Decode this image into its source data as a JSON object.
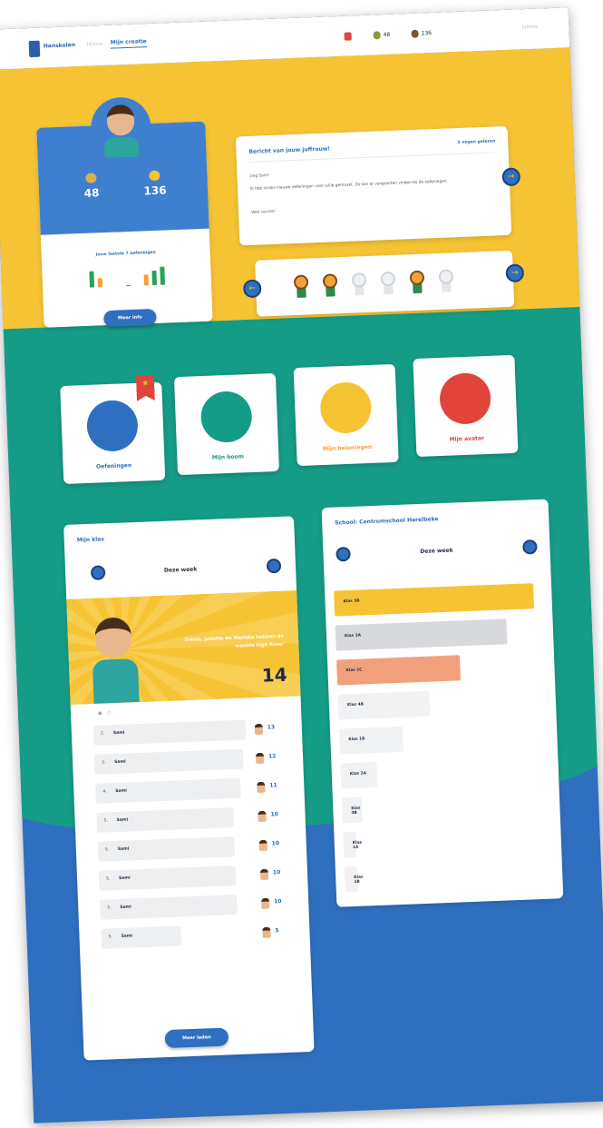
{
  "nav": {
    "logo_text": "Hanskolen",
    "links": [
      "Home",
      "Mijn creatie"
    ],
    "high_fives": "48",
    "badge_count": "136",
    "user_menu": "Juliette"
  },
  "profile": {
    "coins": "48",
    "high_fives": "136",
    "coins_label": "",
    "high_fives_label": "",
    "rewards_label": "Jouw laatste 7 oefeningen",
    "button_label": "Meer info",
    "mini_bars": [
      0.9,
      0.5,
      0.0,
      0.6,
      0.8,
      1.0
    ]
  },
  "message": {
    "title": "Bericht van jouw juffrouw!",
    "more_link": "3 nogen gelezen",
    "greeting": "Dag Sam!",
    "body": "Ik heb straks nieuwe oefeningen voor jullie gemaakt. Ze kan er vergaarden vinden bij de oefeningen.",
    "sign_off": "Veel succes!"
  },
  "badges": {
    "states": [
      "gold",
      "gold",
      "grey",
      "grey",
      "gold",
      "grey"
    ]
  },
  "tiles": [
    {
      "label": "Oefeningen",
      "color": "#2f6fbf",
      "label_color": "#2f6fbf"
    },
    {
      "label": "Mijn boom",
      "color": "#159c86",
      "label_color": "#159c86"
    },
    {
      "label": "Mijn beloningen",
      "color": "#f6c334",
      "label_color": "#f6a134"
    },
    {
      "label": "Mijn avatar",
      "color": "#e0443a",
      "label_color": "#e0443a"
    }
  ],
  "klas": {
    "title": "Mijn klas",
    "week": "Deze week",
    "hero_text": "Simon, Juliette en Mariska hebben de meeste high fives!",
    "hero_number": "14",
    "rows": [
      {
        "pos": "2.",
        "name": "Sami",
        "score": "13",
        "fill": 0.8
      },
      {
        "pos": "3.",
        "name": "Sami",
        "score": "12",
        "fill": 0.78
      },
      {
        "pos": "4.",
        "name": "Sami",
        "score": "11",
        "fill": 0.76
      },
      {
        "pos": "5.",
        "name": "Sami",
        "score": "10",
        "fill": 0.72
      },
      {
        "pos": "5.",
        "name": "Sami",
        "score": "10",
        "fill": 0.72
      },
      {
        "pos": "5.",
        "name": "Sami",
        "score": "10",
        "fill": 0.72
      },
      {
        "pos": "5.",
        "name": "Sami",
        "score": "10",
        "fill": 0.72
      },
      {
        "pos": "5.",
        "name": "Sami",
        "score": "5",
        "fill": 0.42
      }
    ],
    "button_label": "Meer laden"
  },
  "school": {
    "title": "School: Centrumschool Harelbeke",
    "week": "Deze week",
    "rows": [
      {
        "label": "Klas 5B",
        "fill": 1.0,
        "color": "#f6c334"
      },
      {
        "label": "Klas 3A",
        "fill": 0.86,
        "color": "#d7d9dd"
      },
      {
        "label": "Klas 2C",
        "fill": 0.62,
        "color": "#f2a07c"
      },
      {
        "label": "Klas 4B",
        "fill": 0.46,
        "color": "#f1f2f4"
      },
      {
        "label": "Klas 1B",
        "fill": 0.32,
        "color": "#f1f2f4"
      },
      {
        "label": "Klas 2A",
        "fill": 0.18,
        "color": "#f1f2f4"
      },
      {
        "label": "Klas 3B",
        "fill": 0.1,
        "color": "#f1f2f4"
      },
      {
        "label": "Klas 1A",
        "fill": 0.06,
        "color": "#f1f2f4"
      },
      {
        "label": "Klas 1B",
        "fill": 0.03,
        "color": "#f1f2f4"
      }
    ]
  },
  "colors": {
    "primary": "#2f6fbf",
    "yellow": "#f6c334",
    "teal": "#159c86",
    "red": "#e0443a",
    "green": "#28a35a",
    "orange": "#f2a237"
  }
}
